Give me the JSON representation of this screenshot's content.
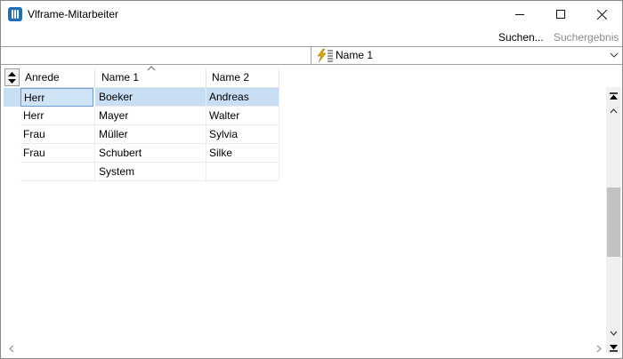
{
  "window": {
    "title": "Vlframe-Mitarbeiter",
    "icons": {
      "app": "app-columns-icon",
      "minimize": "minimize-icon",
      "maximize": "maximize-icon",
      "close": "close-icon"
    }
  },
  "toolbar": {
    "search_label": "Suchen...",
    "result_label": "Suchergebnis"
  },
  "sort": {
    "selected": "Name 1",
    "icon": "sort-lightning-icon"
  },
  "grid": {
    "columns": [
      "Anrede",
      "Name 1",
      "Name 2"
    ],
    "sorted_column": "Name 1",
    "rows": [
      [
        "Herr",
        "Boeker",
        "Andreas"
      ],
      [
        "Herr",
        "Mayer",
        "Walter"
      ],
      [
        "Frau",
        "Müller",
        "Sylvia"
      ],
      [
        "Frau",
        "Schubert",
        "Silke"
      ],
      [
        "",
        "System",
        ""
      ]
    ],
    "selected_row": 0
  },
  "colors": {
    "selection": "#c7def4",
    "accent": "#1f6fb7",
    "disabled_text": "#8c8c8c"
  }
}
